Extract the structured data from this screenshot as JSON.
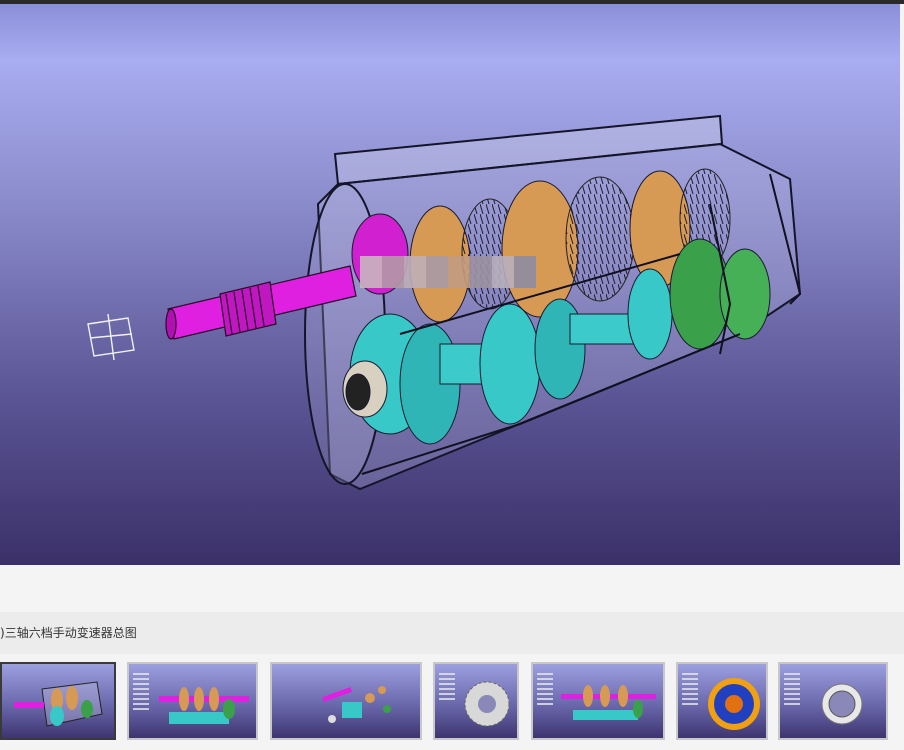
{
  "caption": "三轴六档手动变速器总图",
  "caption_prefix": ")",
  "colors": {
    "shaft_magenta": "#e020e0",
    "gear_cyan": "#38c8c8",
    "gear_orange": "#d79a55",
    "gear_green": "#3aa04a",
    "housing_line": "#1a1a2a"
  },
  "thumbnails": [
    {
      "name": "assembly-view",
      "active": true
    },
    {
      "name": "assembly-tree-view",
      "active": false
    },
    {
      "name": "exploded-view",
      "active": false
    },
    {
      "name": "gear-view",
      "active": false
    },
    {
      "name": "shaft-assembly-view",
      "active": false
    },
    {
      "name": "synchronizer-ring-view",
      "active": false
    },
    {
      "name": "bearing-view",
      "active": false
    }
  ]
}
